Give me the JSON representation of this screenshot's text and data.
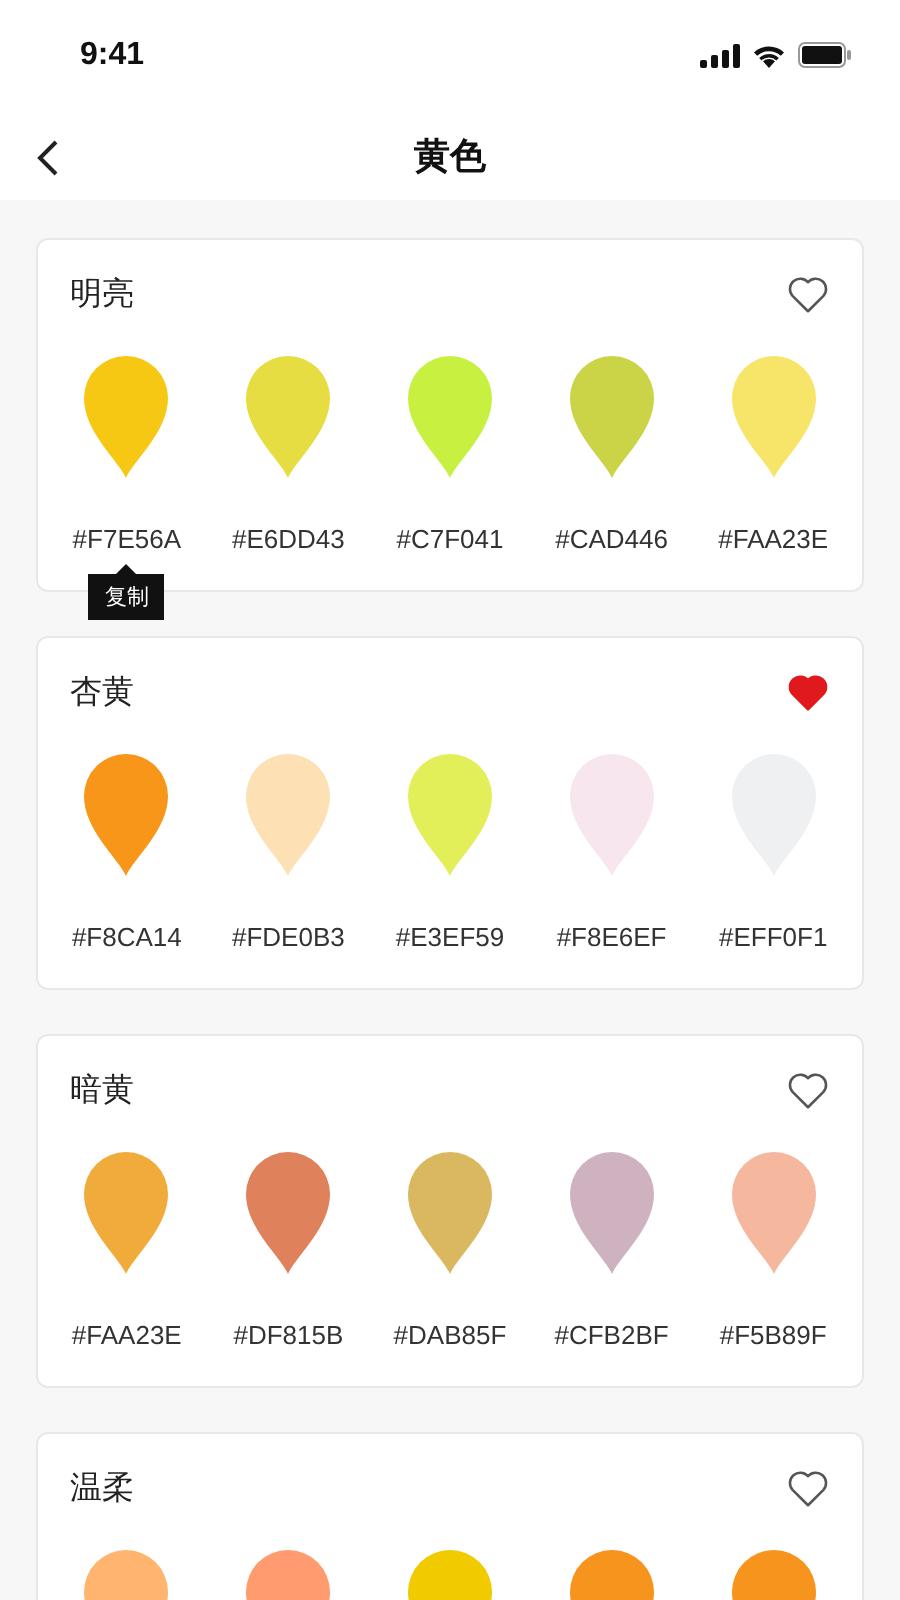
{
  "status_bar": {
    "time": "9:41"
  },
  "header": {
    "title": "黄色"
  },
  "palettes": [
    {
      "name": "明亮",
      "favorite": false,
      "swatches": [
        {
          "color": "#f6c814",
          "hex": "#F7E56A",
          "tooltip": "复制"
        },
        {
          "color": "#e6dd43",
          "hex": "#E6DD43"
        },
        {
          "color": "#c7f041",
          "hex": "#C7F041"
        },
        {
          "color": "#cad446",
          "hex": "#CAD446"
        },
        {
          "color": "#f7e56a",
          "hex": "#FAA23E"
        }
      ]
    },
    {
      "name": "杏黄",
      "favorite": true,
      "swatches": [
        {
          "color": "#f8961a",
          "hex": "#F8CA14"
        },
        {
          "color": "#fde0b3",
          "hex": "#FDE0B3"
        },
        {
          "color": "#e3ef59",
          "hex": "#E3EF59"
        },
        {
          "color": "#f8e6ef",
          "hex": "#F8E6EF"
        },
        {
          "color": "#eff0f1",
          "hex": "#EFF0F1"
        }
      ]
    },
    {
      "name": "暗黄",
      "favorite": false,
      "swatches": [
        {
          "color": "#f1ab3a",
          "hex": "#FAA23E"
        },
        {
          "color": "#df815b",
          "hex": "#DF815B"
        },
        {
          "color": "#dab85f",
          "hex": "#DAB85F"
        },
        {
          "color": "#cfb2bf",
          "hex": "#CFB2BF"
        },
        {
          "color": "#f5b89f",
          "hex": "#F5B89F"
        }
      ]
    },
    {
      "name": "温柔",
      "favorite": false,
      "swatches": [
        {
          "color": "#ffb570"
        },
        {
          "color": "#ff9b6e"
        },
        {
          "color": "#f1ca00"
        },
        {
          "color": "#f7941d"
        },
        {
          "color": "#f7941d"
        }
      ]
    }
  ]
}
